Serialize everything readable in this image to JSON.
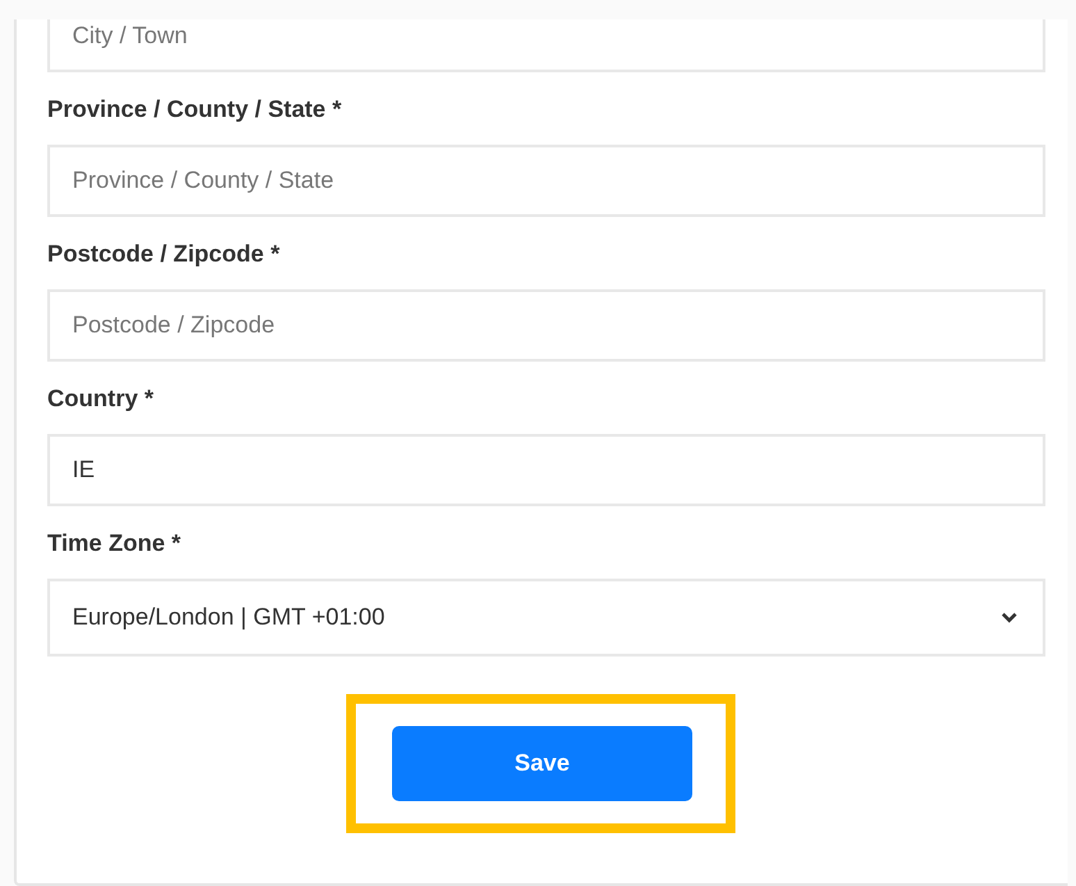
{
  "fields": [
    {
      "kind": "text",
      "placeholder": "City / Town"
    },
    {
      "kind": "text",
      "label": "Province / County / State *",
      "placeholder": "Province / County / State"
    },
    {
      "kind": "text",
      "label": "Postcode / Zipcode *",
      "placeholder": "Postcode / Zipcode"
    },
    {
      "kind": "text",
      "label": "Country *",
      "value": "IE"
    },
    {
      "kind": "select",
      "label": "Time Zone *",
      "value": "Europe/London | GMT +01:00"
    }
  ],
  "save_button": {
    "label": "Save",
    "highlighted": true
  }
}
